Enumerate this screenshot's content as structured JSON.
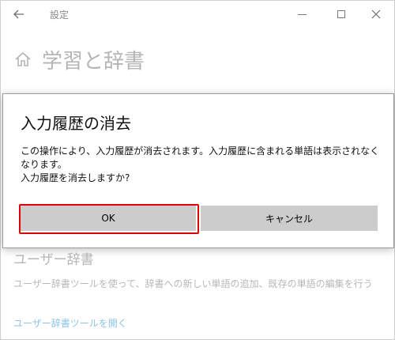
{
  "window": {
    "app_title": "設定",
    "back_icon": "back-arrow-icon",
    "controls": [
      "minimize-icon",
      "maximize-icon",
      "close-icon"
    ]
  },
  "page": {
    "home_icon": "home-icon",
    "title": "学習と辞書"
  },
  "background_section": {
    "heading": "ユーザー辞書",
    "description": "ユーザー辞書ツールを使って、辞書への新しい単語の追加、既存の単語の編集を行う",
    "link": "ユーザー辞書ツールを開く"
  },
  "dialog": {
    "title": "入力履歴の消去",
    "message": "この操作により、入力履歴が消去されます。入力履歴に含まれる単語は表示されなくなります。\n入力履歴を消去しますか?",
    "ok_label": "OK",
    "cancel_label": "キャンセル",
    "highlight_color": "#e00000"
  }
}
